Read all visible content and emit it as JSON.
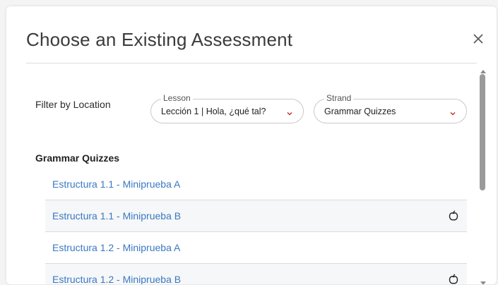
{
  "dialog": {
    "title": "Choose an Existing Assessment",
    "close_icon": "close-icon"
  },
  "filter": {
    "label": "Filter by Location",
    "lesson": {
      "legend": "Lesson",
      "value": "Lección 1 | Hola, ¿qué tal?"
    },
    "strand": {
      "legend": "Strand",
      "value": "Grammar Quizzes"
    },
    "chevron_color": "#c0392b"
  },
  "section": {
    "title": "Grammar Quizzes",
    "items": [
      {
        "label": "Estructura 1.1 - Miniprueba A",
        "has_status_icon": false
      },
      {
        "label": "Estructura 1.1 - Miniprueba B",
        "has_status_icon": true
      },
      {
        "label": "Estructura 1.2 - Miniprueba A",
        "has_status_icon": false
      },
      {
        "label": "Estructura 1.2 - Miniprueba B",
        "has_status_icon": true
      }
    ]
  },
  "colors": {
    "link": "#3a78c3",
    "accent": "#c0392b"
  }
}
